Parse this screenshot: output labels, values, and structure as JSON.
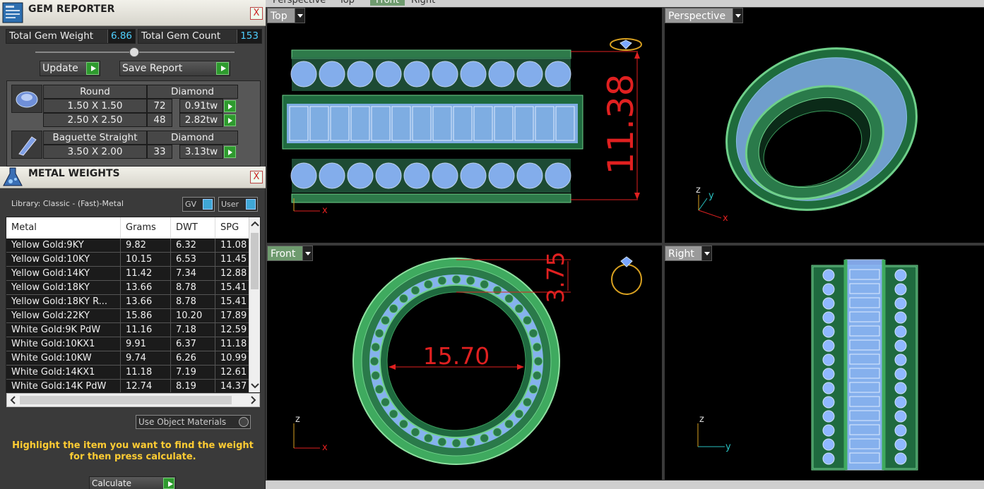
{
  "gem_reporter": {
    "title": "GEM REPORTER",
    "close": "X",
    "total_weight_label": "Total Gem Weight",
    "total_weight_value": "6.86",
    "total_count_label": "Total Gem Count",
    "total_count_value": "153",
    "update_label": "Update",
    "save_label": "Save Report",
    "groups": [
      {
        "icon": "round-diamond-icon",
        "shape": "Round",
        "material": "Diamond",
        "rows": [
          {
            "size": "1.50 X 1.50",
            "count": "72",
            "weight": "0.91tw"
          },
          {
            "size": "2.50 X 2.50",
            "count": "48",
            "weight": "2.82tw"
          }
        ]
      },
      {
        "icon": "baguette-diamond-icon",
        "shape": "Baguette Straight",
        "material": "Diamond",
        "rows": [
          {
            "size": "3.50 X 2.00",
            "count": "33",
            "weight": "3.13tw"
          }
        ]
      }
    ]
  },
  "metal_weights": {
    "title": "METAL WEIGHTS",
    "close": "X",
    "library": "Library: Classic - (Fast)-Metal",
    "gv_label": "GV",
    "user_label": "User",
    "columns": [
      "Metal",
      "Grams",
      "DWT",
      "SPG"
    ],
    "rows": [
      [
        "Yellow Gold:9KY",
        "9.82",
        "6.32",
        "11.08"
      ],
      [
        "Yellow Gold:10KY",
        "10.15",
        "6.53",
        "11.45"
      ],
      [
        "Yellow Gold:14KY",
        "11.42",
        "7.34",
        "12.88"
      ],
      [
        "Yellow Gold:18KY",
        "13.66",
        "8.78",
        "15.41"
      ],
      [
        "Yellow Gold:18KY R...",
        "13.66",
        "8.78",
        "15.41"
      ],
      [
        "Yellow Gold:22KY",
        "15.86",
        "10.20",
        "17.89"
      ],
      [
        "White Gold:9K PdW",
        "11.16",
        "7.18",
        "12.59"
      ],
      [
        "White Gold:10KX1",
        "9.91",
        "6.37",
        "11.18"
      ],
      [
        "White Gold:10KW",
        "9.74",
        "6.26",
        "10.99"
      ],
      [
        "White Gold:14KX1",
        "11.18",
        "7.19",
        "12.61"
      ],
      [
        "White Gold:14K PdW",
        "12.74",
        "8.19",
        "14.37"
      ]
    ],
    "use_object_materials": "Use Object Materials",
    "hint": "Highlight the item you want to find the weight for then press calculate.",
    "calculate_label": "Calculate"
  },
  "top_tabs": [
    "Perspective",
    "Top",
    "Front",
    "Right"
  ],
  "viewports": {
    "top": {
      "label": "Top",
      "dimension": "11.38",
      "axis_x": "x"
    },
    "perspective": {
      "label": "Perspective",
      "axis_x": "x",
      "axis_y": "y",
      "axis_z": "z"
    },
    "front": {
      "label": "Front",
      "dimension_outer": "3.75",
      "dimension_inner": "15.70",
      "axis_x": "x",
      "axis_z": "z"
    },
    "right": {
      "label": "Right",
      "axis_y": "y",
      "axis_z": "z"
    }
  },
  "colors": {
    "ring_green": "#3faa5f",
    "gem_blue": "#8fb8ff",
    "dimension_red": "#e02020",
    "highlight_yellow": "#ffcc33"
  }
}
